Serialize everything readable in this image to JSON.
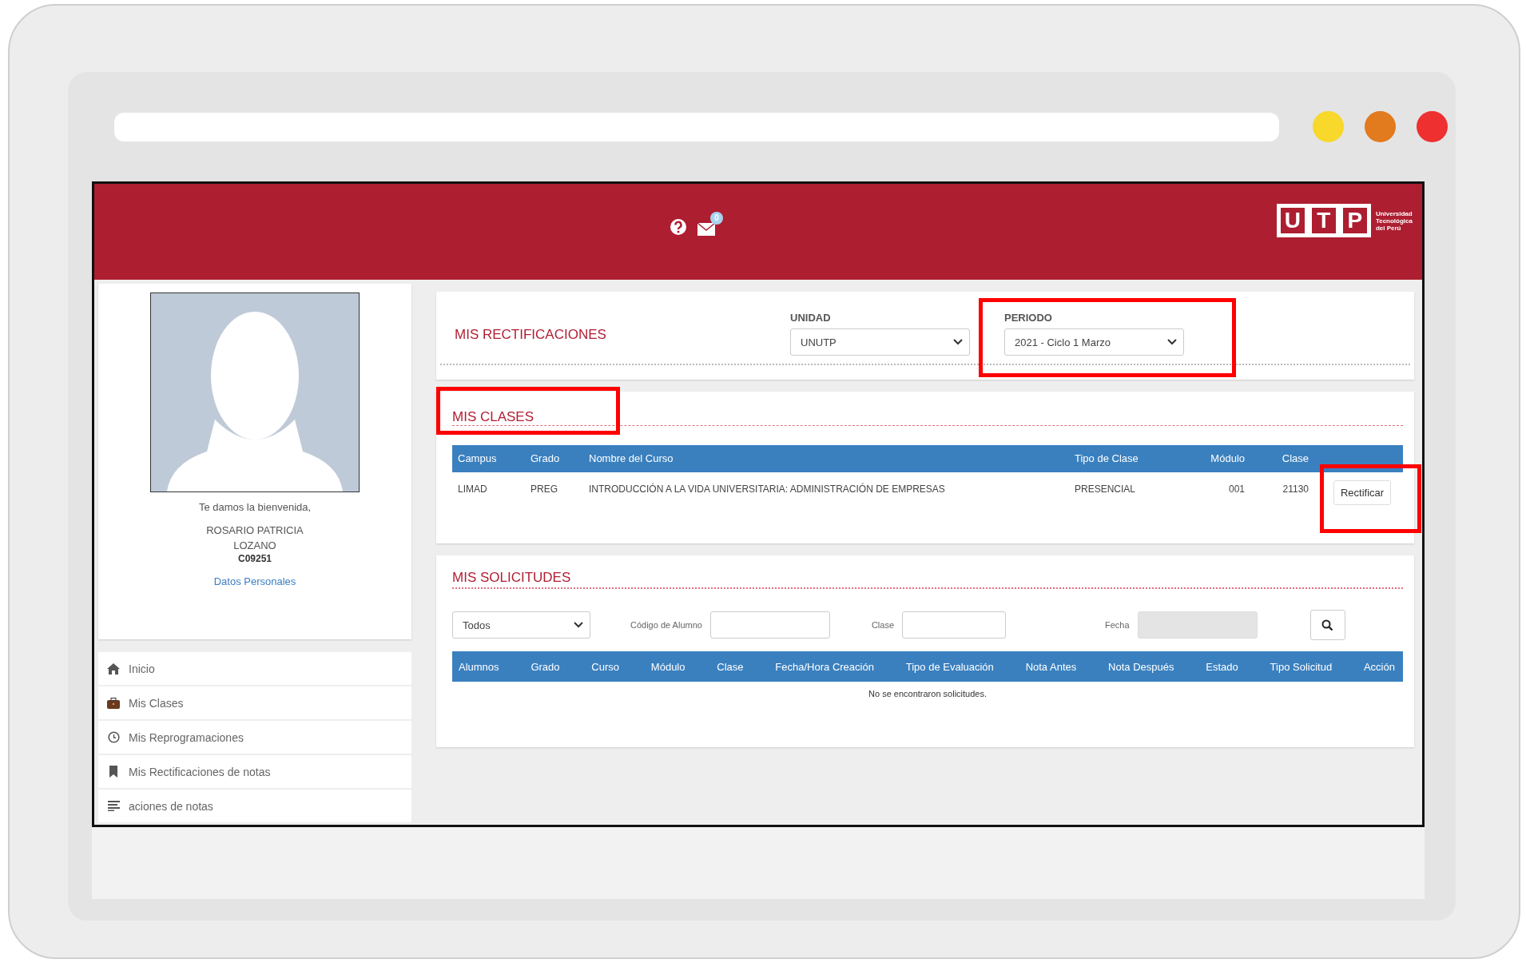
{
  "header": {
    "mail_count": "0"
  },
  "logo": {
    "letters": [
      "U",
      "T",
      "P"
    ],
    "caption": [
      "Universidad",
      "Tecnológica",
      "del Perú"
    ]
  },
  "profile": {
    "greeting": "Te damos la bienvenida,",
    "name_lines": [
      "ROSARIO PATRICIA",
      "LOZANO"
    ],
    "code": "C09251",
    "link": "Datos Personales"
  },
  "menu": [
    {
      "label": "Inicio",
      "kind": "home"
    },
    {
      "label": "Mis Clases",
      "kind": "briefcase"
    },
    {
      "label": "Mis Reprogramaciones",
      "kind": "clock"
    },
    {
      "label": "Mis Rectificaciones de notas",
      "kind": "bookmark"
    },
    {
      "label": "aciones de notas",
      "kind": "list"
    }
  ],
  "rectificaciones": {
    "title": "MIS RECTIFICACIONES",
    "filters": [
      {
        "label": "UNIDAD",
        "value": "UNUTP",
        "highlighted": false
      },
      {
        "label": "PERIODO",
        "value": "2021 - Ciclo 1 Marzo",
        "highlighted": true
      }
    ]
  },
  "clases": {
    "title": "MIS CLASES",
    "highlighted": true,
    "columns": [
      "Campus",
      "Grado",
      "Nombre del Curso",
      "Tipo de Clase",
      "Módulo",
      "Clase"
    ],
    "rows": [
      {
        "cells": [
          "LIMAD",
          "PREG",
          "INTRODUCCIÓN A LA VIDA UNIVERSITARIA: ADMINISTRACIÓN DE EMPRESAS",
          "PRESENCIAL",
          "001",
          "21130"
        ],
        "action": "Rectificar",
        "action_highlighted": true
      }
    ]
  },
  "solicitudes": {
    "title": "MIS SOLICITUDES",
    "status_filter": "Todos",
    "fields": [
      {
        "label": "Código de Alumno",
        "disabled": false
      },
      {
        "label": "Clase",
        "disabled": false
      },
      {
        "label": "Fecha",
        "disabled": true
      }
    ],
    "columns": [
      "Alumnos",
      "Grado",
      "Curso",
      "Módulo",
      "Clase",
      "Fecha/Hora Creación",
      "Tipo de Evaluación",
      "Nota Antes",
      "Nota Después",
      "Estado",
      "Tipo Solicitud",
      "Acción"
    ],
    "empty": "No se encontraron solicitudes."
  }
}
